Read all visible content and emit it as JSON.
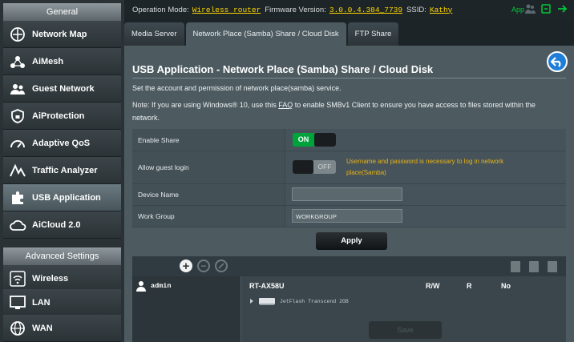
{
  "sidebar": {
    "general_header": "General",
    "items": [
      {
        "label": "Network Map",
        "icon": "network-map-icon"
      },
      {
        "label": "AiMesh",
        "icon": "aimesh-icon"
      },
      {
        "label": "Guest Network",
        "icon": "guest-network-icon"
      },
      {
        "label": "AiProtection",
        "icon": "shield-lock-icon"
      },
      {
        "label": "Adaptive QoS",
        "icon": "speedometer-icon"
      },
      {
        "label": "Traffic Analyzer",
        "icon": "traffic-analyzer-icon"
      },
      {
        "label": "USB Application",
        "icon": "usb-puzzle-icon"
      },
      {
        "label": "AiCloud 2.0",
        "icon": "cloud-icon"
      }
    ],
    "advanced_header": "Advanced Settings",
    "advanced_items": [
      {
        "label": "Wireless",
        "icon": "wifi-icon"
      },
      {
        "label": "LAN",
        "icon": "lan-icon"
      },
      {
        "label": "WAN",
        "icon": "globe-icon"
      }
    ]
  },
  "topbar": {
    "op_mode_label": "Operation Mode:",
    "op_mode_value": "Wireless router",
    "firmware_label": "Firmware Version:",
    "firmware_value": "3.0.0.4.384_7739",
    "ssid_label": "SSID:",
    "ssid_value": "Kathy",
    "app_label": "App"
  },
  "tabs": [
    {
      "label": "Media Server"
    },
    {
      "label": "Network Place (Samba) Share / Cloud Disk"
    },
    {
      "label": "FTP Share"
    }
  ],
  "main": {
    "title": "USB Application - Network Place (Samba) Share / Cloud Disk",
    "desc1": "Set the account and permission of network place(samba) service.",
    "note_pre": "Note: If you are using Windows® 10, use this ",
    "note_faq": "FAQ",
    "note_post": " to enable SMBv1 Client to ensure you have access to files stored within the",
    "note_line2": "network."
  },
  "settings": {
    "enable_share_label": "Enable Share",
    "enable_share_state": "ON",
    "guest_login_label": "Allow guest login",
    "guest_login_state": "OFF",
    "guest_login_note": "Username and password is necessary to log in network place(Samba)",
    "device_name_label": "Device Name",
    "device_name_value": "",
    "work_group_label": "Work Group",
    "work_group_value": "WORKGROUP",
    "apply_label": "Apply"
  },
  "share": {
    "user": "admin",
    "device": "RT-AX58U",
    "col_rw": "R/W",
    "col_r": "R",
    "col_no": "No",
    "drive": "JetFlash Transcend 2GB",
    "save_label": "Save"
  },
  "colors": {
    "accent_green": "#00a23c",
    "note_yellow": "#e8b418",
    "link_yellow": "#ffd700",
    "back_blue": "#1f7ed8"
  }
}
